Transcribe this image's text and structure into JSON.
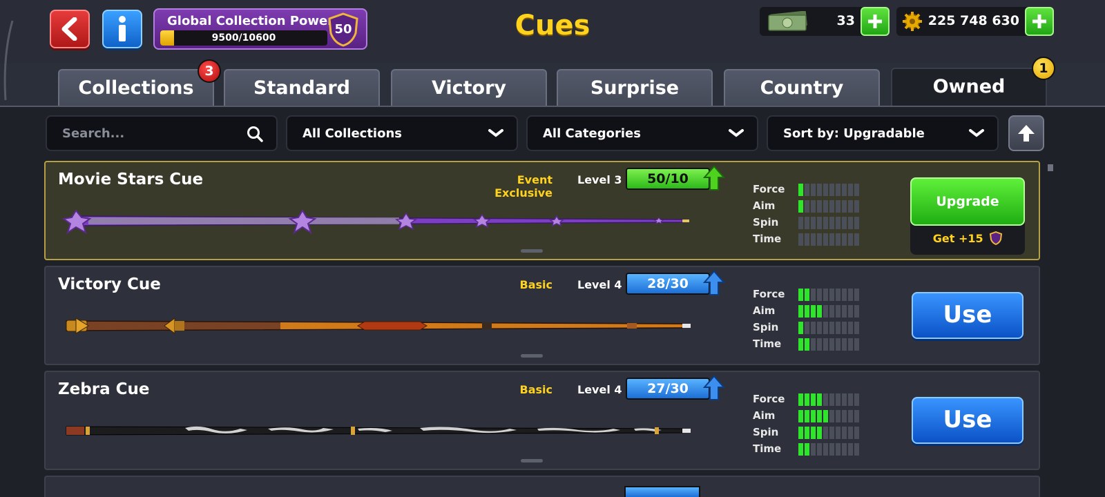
{
  "header": {
    "title": "Cues",
    "back_icon": "back-arrow-icon",
    "info_icon": "info-icon",
    "collection_power": {
      "label": "Global Collection Power",
      "progress_text": "9500/10600",
      "progress_fraction": 0.0826,
      "level": "50"
    },
    "cash": {
      "value": "33",
      "icon": "cash-icon"
    },
    "coins": {
      "value": "225 748 630",
      "icon": "gear-coin-icon"
    }
  },
  "tabs": [
    {
      "label": "Collections",
      "badge": "3"
    },
    {
      "label": "Standard"
    },
    {
      "label": "Victory"
    },
    {
      "label": "Surprise"
    },
    {
      "label": "Country"
    },
    {
      "label": "Owned",
      "badge": "1",
      "active": true
    }
  ],
  "filters": {
    "search_placeholder": "Search...",
    "collection": "All Collections",
    "category": "All Categories",
    "sort": "Sort by: Upgradable"
  },
  "stat_labels": [
    "Force",
    "Aim",
    "Spin",
    "Time"
  ],
  "cues": [
    {
      "name": "Movie Stars Cue",
      "category": "Event Exclusive",
      "level": "Level 3",
      "progress": "50/10",
      "stats": [
        1,
        1,
        0,
        0
      ],
      "action": "Upgrade",
      "bonus": "Get +15",
      "selected": true
    },
    {
      "name": "Victory Cue",
      "category": "Basic",
      "level": "Level 4",
      "progress": "28/30",
      "stats": [
        2,
        4,
        1,
        2
      ],
      "action": "Use"
    },
    {
      "name": "Zebra Cue",
      "category": "Basic",
      "level": "Level 4",
      "progress": "27/30",
      "stats": [
        4,
        5,
        4,
        2
      ],
      "action": "Use"
    }
  ],
  "colors": {
    "accent_yellow": "#ffd21e",
    "stat_on": "#2fe52b",
    "use_blue": "#1c6fd6",
    "upgrade_green": "#2db91a"
  }
}
